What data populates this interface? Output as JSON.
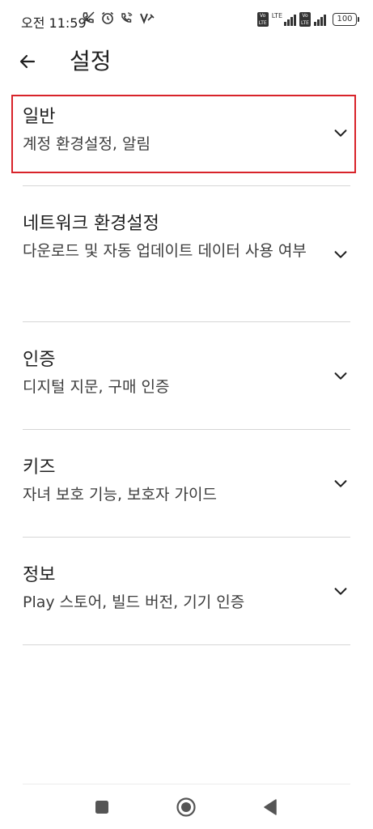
{
  "status_bar": {
    "time": "오전 11:59",
    "lte_label": "LTE",
    "volte_label": "Vo LTE",
    "battery": "100"
  },
  "app_bar": {
    "title": "설정"
  },
  "sections": [
    {
      "title": "일반",
      "subtitle": "계정 환경설정, 알림"
    },
    {
      "title": "네트워크 환경설정",
      "subtitle": "다운로드 및 자동 업데이트 데이터 사용 여부"
    },
    {
      "title": "인증",
      "subtitle": "디지털 지문, 구매 인증"
    },
    {
      "title": "키즈",
      "subtitle": "자녀 보호 기능, 보호자 가이드"
    },
    {
      "title": "정보",
      "subtitle": "Play 스토어, 빌드 버전, 기기 인증"
    }
  ],
  "colors": {
    "highlight": "#d8232a",
    "text": "#1f1f1f",
    "divider": "#d6d6d6"
  },
  "icons": {
    "back": "arrow-left-icon",
    "expand": "chevron-down-icon",
    "nav_recent": "square-icon",
    "nav_home": "circle-icon",
    "nav_back": "triangle-icon"
  }
}
